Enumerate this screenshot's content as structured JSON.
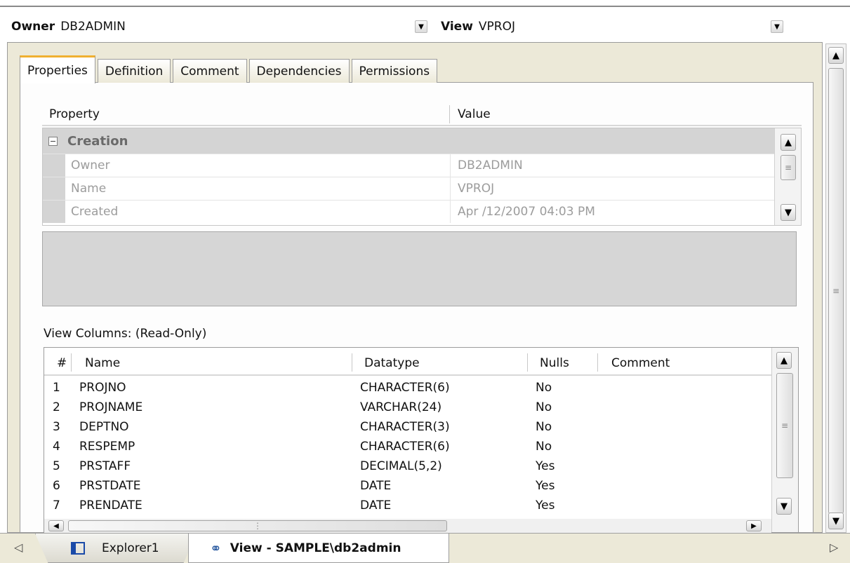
{
  "header": {
    "owner_label": "Owner",
    "owner_value": "DB2ADMIN",
    "view_label": "View",
    "view_value": "VPROJ"
  },
  "tabs": [
    {
      "label": "Properties"
    },
    {
      "label": "Definition"
    },
    {
      "label": "Comment"
    },
    {
      "label": "Dependencies"
    },
    {
      "label": "Permissions"
    }
  ],
  "properties": {
    "col_property": "Property",
    "col_value": "Value",
    "group": "Creation",
    "rows": [
      {
        "name": "Owner",
        "value": "DB2ADMIN"
      },
      {
        "name": "Name",
        "value": "VPROJ"
      },
      {
        "name": "Created",
        "value": "Apr /12/2007 04:03 PM"
      }
    ]
  },
  "columns": {
    "label": "View Columns: (Read-Only)",
    "headers": {
      "num": "#",
      "name": "Name",
      "datatype": "Datatype",
      "nulls": "Nulls",
      "comment": "Comment"
    },
    "rows": [
      {
        "num": "1",
        "name": "PROJNO",
        "datatype": "CHARACTER(6)",
        "nulls": "No",
        "comment": ""
      },
      {
        "num": "2",
        "name": "PROJNAME",
        "datatype": "VARCHAR(24)",
        "nulls": "No",
        "comment": ""
      },
      {
        "num": "3",
        "name": "DEPTNO",
        "datatype": "CHARACTER(3)",
        "nulls": "No",
        "comment": ""
      },
      {
        "num": "4",
        "name": "RESPEMP",
        "datatype": "CHARACTER(6)",
        "nulls": "No",
        "comment": ""
      },
      {
        "num": "5",
        "name": "PRSTAFF",
        "datatype": "DECIMAL(5,2)",
        "nulls": "Yes",
        "comment": ""
      },
      {
        "num": "6",
        "name": "PRSTDATE",
        "datatype": "DATE",
        "nulls": "Yes",
        "comment": ""
      },
      {
        "num": "7",
        "name": "PRENDATE",
        "datatype": "DATE",
        "nulls": "Yes",
        "comment": ""
      }
    ]
  },
  "bottom_tabs": [
    {
      "label": "Explorer1",
      "icon": "panel-icon"
    },
    {
      "label": "View - SAMPLE\\db2admin",
      "icon": "binoculars-icon"
    }
  ]
}
